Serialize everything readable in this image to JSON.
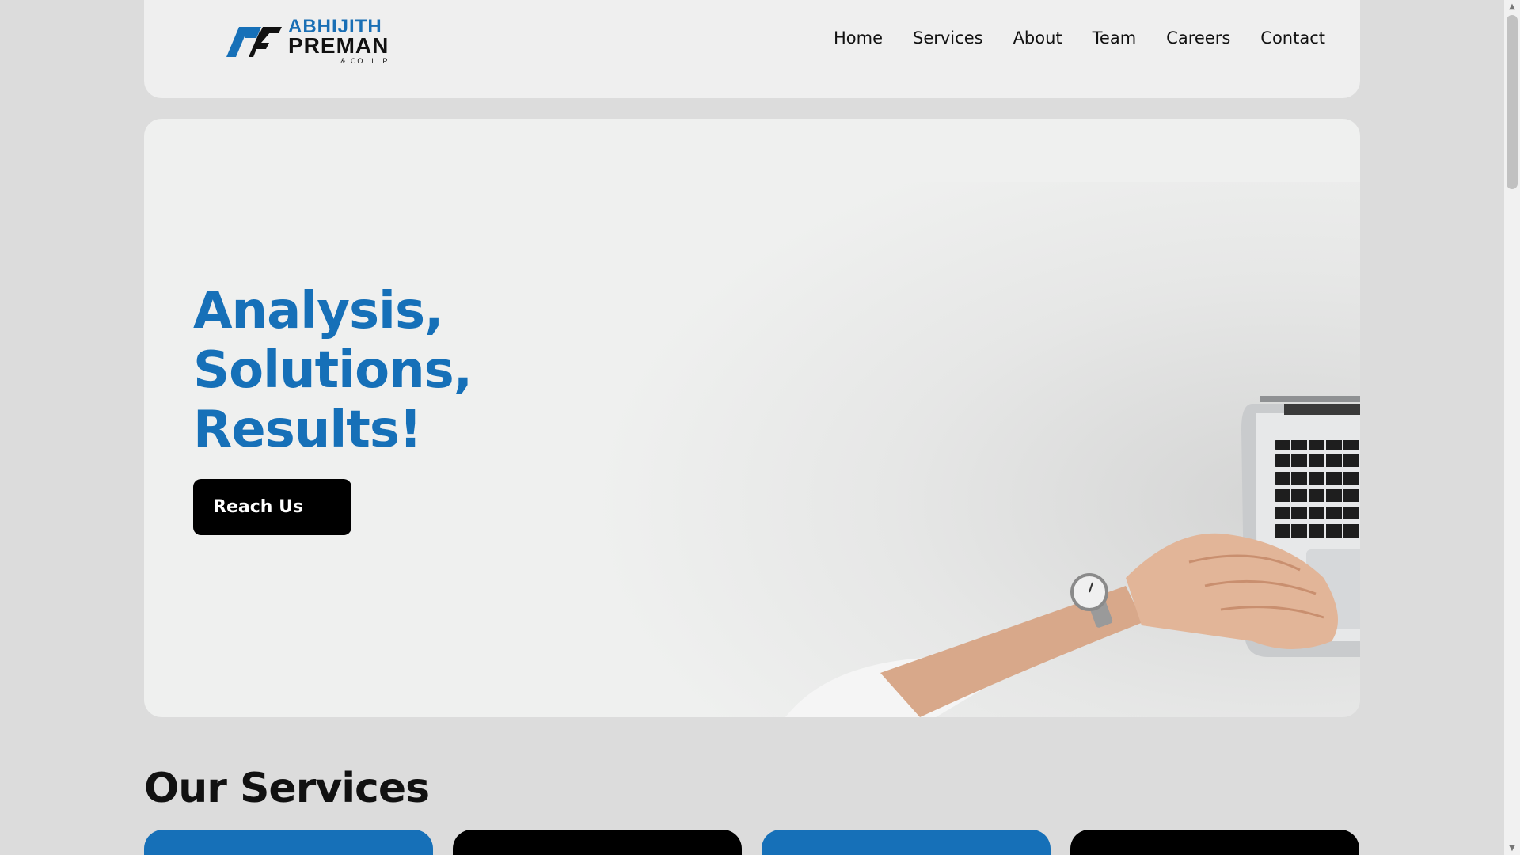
{
  "brand": {
    "line1": "ABHIJITH",
    "line2": "PREMAN",
    "line3": "& CO. LLP",
    "color_primary": "#1670b8",
    "color_dark": "#111111"
  },
  "nav": {
    "items": [
      {
        "label": "Home"
      },
      {
        "label": "Services"
      },
      {
        "label": "About"
      },
      {
        "label": "Team"
      },
      {
        "label": "Careers"
      },
      {
        "label": "Contact"
      }
    ]
  },
  "hero": {
    "title_lines": [
      "Analysis,",
      "Solutions,",
      "Results!"
    ],
    "cta_label": "Reach Us",
    "image_icon": "laptop-hands-illustration"
  },
  "services": {
    "title": "Our Services",
    "card_colors": [
      "#1670b8",
      "#000000",
      "#1670b8",
      "#000000"
    ]
  },
  "icons": {
    "scroll_up": "scroll-up-arrow-icon",
    "scroll_down": "scroll-down-arrow-icon"
  }
}
